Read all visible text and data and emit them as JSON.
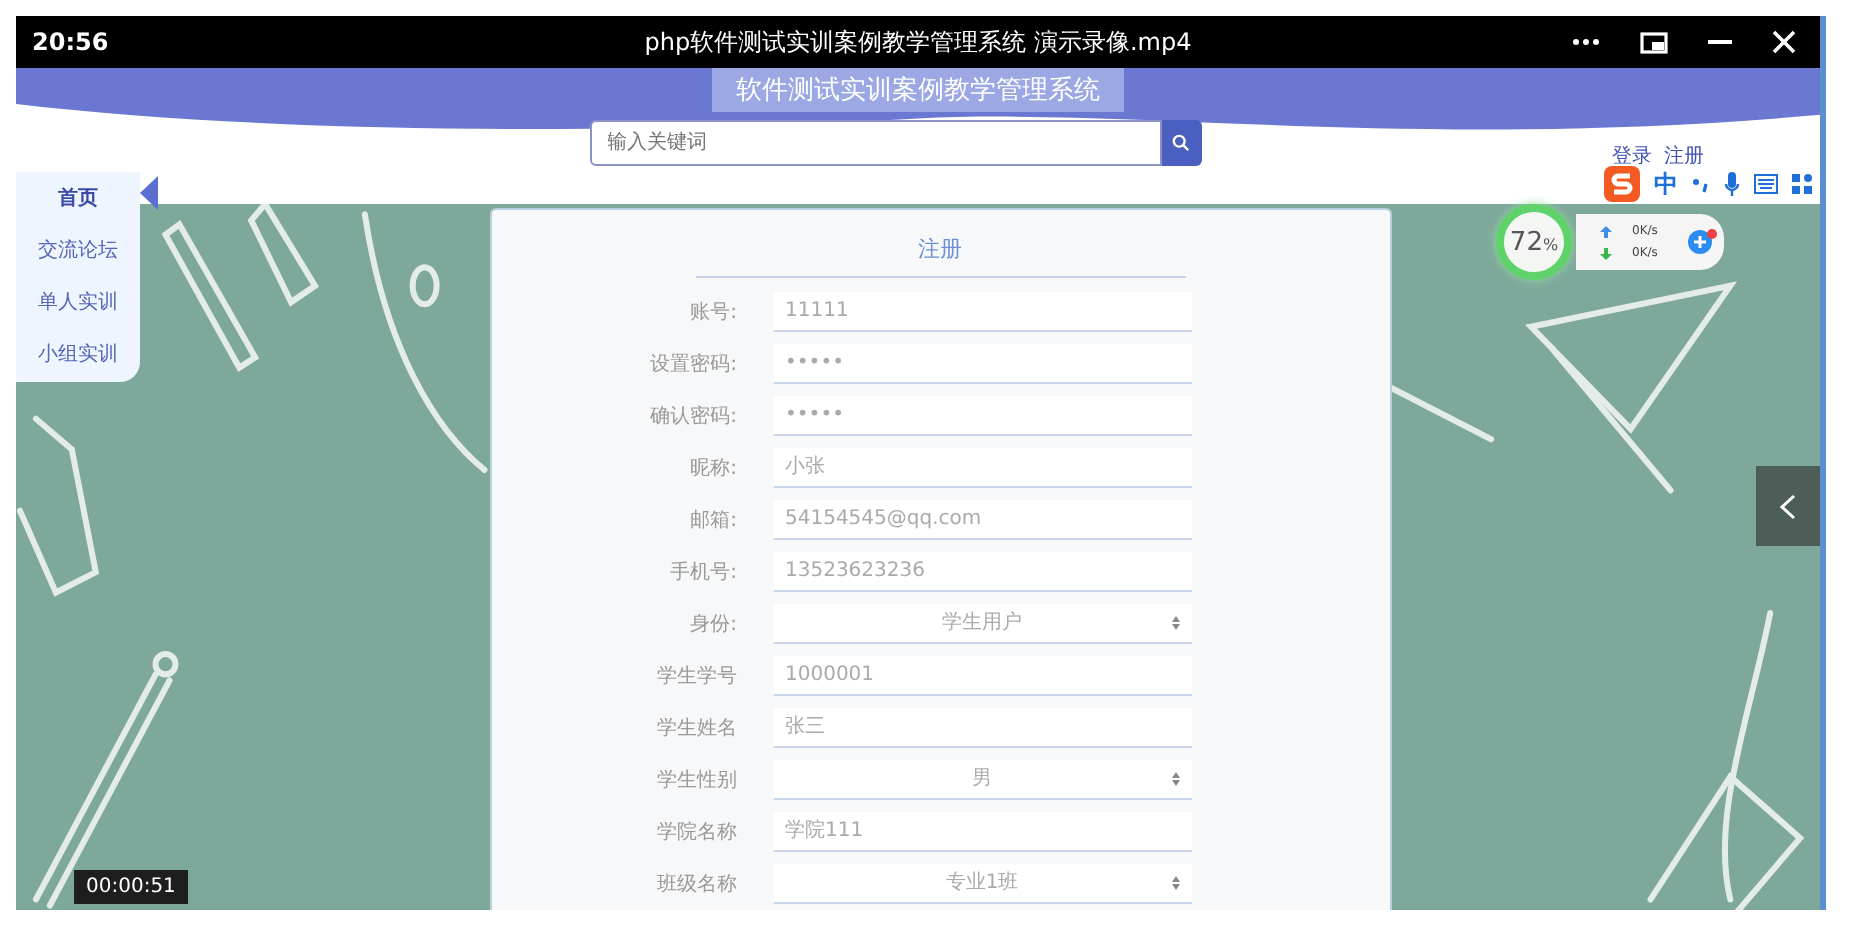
{
  "player": {
    "time": "20:56",
    "title": "php软件测试实训案例教学管理系统 演示录像.mp4",
    "timestamp": "00:00:51"
  },
  "site": {
    "title": "软件测试实训案例教学管理系统",
    "search": {
      "placeholder": "输入关键词"
    },
    "auth_links": [
      "登录",
      "注册"
    ]
  },
  "nav": [
    {
      "label": "首页",
      "selected": true
    },
    {
      "label": "交流论坛",
      "selected": false
    },
    {
      "label": "单人实训",
      "selected": false
    },
    {
      "label": "小组实训",
      "selected": false
    }
  ],
  "form": {
    "title": "注册",
    "fields": [
      {
        "label": "账号:",
        "kind": "input",
        "value": "11111"
      },
      {
        "label": "设置密码:",
        "kind": "input",
        "value": "•••••"
      },
      {
        "label": "确认密码:",
        "kind": "input",
        "value": "•••••"
      },
      {
        "label": "昵称:",
        "kind": "input",
        "value": "小张"
      },
      {
        "label": "邮箱:",
        "kind": "input",
        "value": "54154545@qq.com"
      },
      {
        "label": "手机号:",
        "kind": "input",
        "value": "13523623236"
      },
      {
        "label": "身份:",
        "kind": "select",
        "value": "学生用户"
      },
      {
        "label": "学生学号",
        "kind": "input",
        "value": "1000001"
      },
      {
        "label": "学生姓名",
        "kind": "input",
        "value": "张三"
      },
      {
        "label": "学生性别",
        "kind": "select",
        "value": "男"
      },
      {
        "label": "学院名称",
        "kind": "input",
        "value": "学院111"
      },
      {
        "label": "班级名称",
        "kind": "select",
        "value": "专业1班"
      }
    ]
  },
  "ime": {
    "mode": "中"
  },
  "speed_widget": {
    "load": "72",
    "unit": "%",
    "upload": "0K/s",
    "download": "0K/s"
  }
}
